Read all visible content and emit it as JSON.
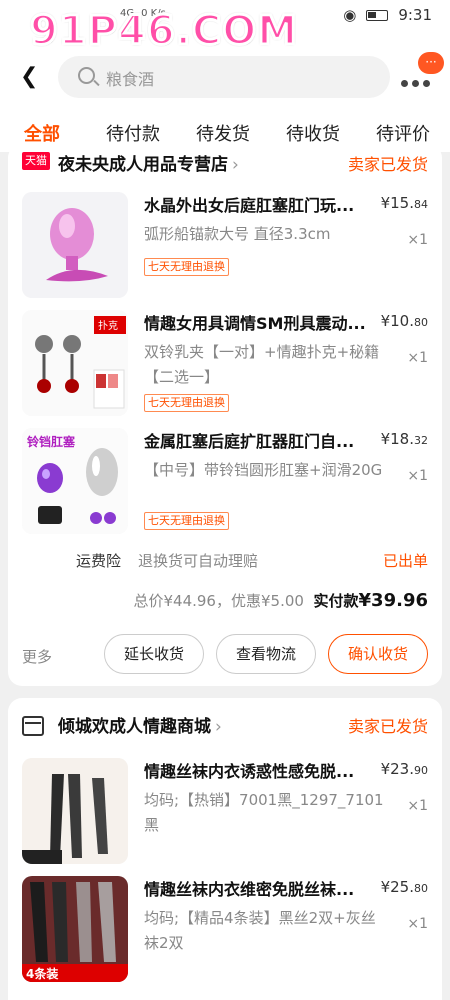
{
  "status_bar": {
    "time": "9:31",
    "network": "4G",
    "speed": "0 K/s"
  },
  "watermark": "91P46.COM",
  "search": {
    "placeholder": "粮食酒"
  },
  "header": {
    "message_count": "···"
  },
  "tabs": [
    {
      "label": "全部",
      "active": true
    },
    {
      "label": "待付款"
    },
    {
      "label": "待发货"
    },
    {
      "label": "待收货"
    },
    {
      "label": "待评价"
    }
  ],
  "order1": {
    "shop_badge": "天猫",
    "shop_name": "夜未央成人用品专营店",
    "status": "卖家已发货",
    "items": [
      {
        "title": "水晶外出女后庭肛塞肛门玩...",
        "sku": "弧形船锚款大号 直径3.3cm",
        "tag": "七天无理由退换",
        "price_symbol": "¥",
        "price_int": "15.",
        "price_dec": "84",
        "qty": "×1"
      },
      {
        "title": "情趣女用具调情SM刑具震动...",
        "sku": "双铃乳夹【一对】+情趣扑克+秘籍【二选一】",
        "tag": "七天无理由退换",
        "price_symbol": "¥",
        "price_int": "10.",
        "price_dec": "80",
        "qty": "×1"
      },
      {
        "title": "金属肛塞后庭扩肛器肛门自...",
        "sku": "【中号】带铃铛圆形肛塞+润滑20G",
        "tag": "七天无理由退换",
        "price_symbol": "¥",
        "price_int": "18.",
        "price_dec": "32",
        "qty": "×1"
      }
    ],
    "insurance_label": "运费险",
    "insurance_desc": "退换货可自动理赔",
    "insurance_status": "已出单",
    "total_label": "总价",
    "total_value": "¥44.96",
    "discount_label": "优惠",
    "discount_value": "¥5.00",
    "paid_label": "实付款",
    "paid_value": "¥39.96",
    "more": "更多",
    "buttons": {
      "extend": "延长收货",
      "logistics": "查看物流",
      "confirm": "确认收货"
    }
  },
  "order2": {
    "shop_name": "倾城欢成人情趣商城",
    "status": "卖家已发货",
    "items": [
      {
        "title": "情趣丝袜内衣诱惑性感免脱...",
        "sku": "均码;【热销】7001黑_1297_7101黑",
        "price_symbol": "¥",
        "price_int": "23.",
        "price_dec": "90",
        "qty": "×1"
      },
      {
        "title": "情趣丝袜内衣维密免脱丝袜...",
        "sku": "均码;【精品4条装】黑丝2双+灰丝袜2双",
        "price_symbol": "¥",
        "price_int": "25.",
        "price_dec": "80",
        "qty": "×1"
      }
    ]
  },
  "thumb_labels": {
    "item2_badge": "扑克",
    "item3_caption": "铃铛肛塞",
    "item5_badge": "4条装"
  },
  "colors": {
    "accent": "#ff5000",
    "tmall": "#ff0036",
    "watermark": "#ff4fa8"
  }
}
